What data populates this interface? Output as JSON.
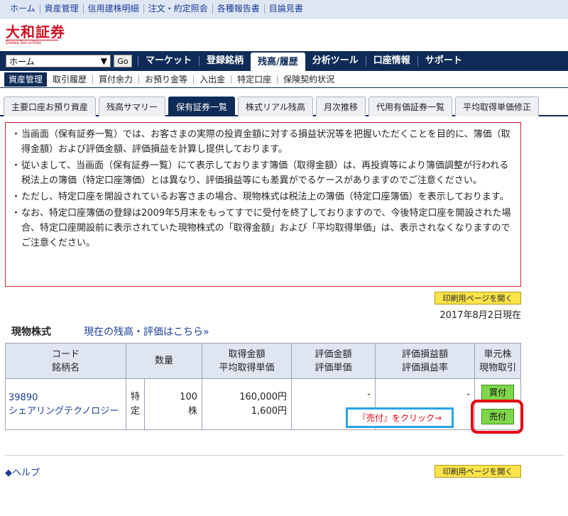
{
  "top_links": [
    "ホーム",
    "資産管理",
    "信用建株明細",
    "注文・約定照会",
    "各種報告書",
    "目論見書"
  ],
  "logo": {
    "text": "大和証券",
    "sub": "Daiwa Securities"
  },
  "navbar": {
    "search_value": "ホーム",
    "go_label": "Go",
    "items": [
      "マーケット",
      "登録銘柄",
      "残高/履歴",
      "分析ツール",
      "口座情報",
      "サポート"
    ],
    "active_index": 2
  },
  "subnav": {
    "items": [
      "資産管理",
      "取引履歴",
      "買付余力",
      "お預り金等",
      "入出金",
      "特定口座",
      "保険契約状況"
    ],
    "active_index": 0
  },
  "tabs": {
    "items": [
      "主要口座お預り資産",
      "残高サマリー",
      "保有証券一覧",
      "株式リアル残高",
      "月次推移",
      "代用有価証券一覧",
      "平均取得単価修正"
    ],
    "active_index": 2
  },
  "notice": [
    "当画面（保有証券一覧）では、お客さまの実際の投資金額に対する損益状況等を把握いただくことを目的に、簿価（取得金額）および評価金額、評価損益を計算し提供しております。",
    "従いまして、当画面（保有証券一覧）にて表示しております簿価（取得金額）は、再投資等により簿価調整が行われる税法上の簿価（特定口座簿価）とは異なり、評価損益等にも差異がでるケースがありますのでご注意ください。",
    "ただし、特定口座を開設されているお客さまの場合、現物株式は税法上の簿価（特定口座簿価）を表示しております。",
    "なお、特定口座簿価の登録は2009年5月末をもってすでに受付を終了しておりますので、今後特定口座を開設された場合、特定口座開設前に表示されていた現物株式の「取得金額」および「平均取得単価」は、表示されなくなりますのでご注意ください。"
  ],
  "print_label": "印刷用ページを開く",
  "date": "2017年8月2日現在",
  "section": {
    "title": "現物株式",
    "link": "現在の残高・評価はこちら»"
  },
  "table": {
    "headers": {
      "code": "コード",
      "name": "銘柄名",
      "qty": "数量",
      "cost": "取得金額",
      "avg": "平均取得単価",
      "value": "評価金額",
      "unit_value": "評価単価",
      "pl": "評価損益額",
      "pl_rate": "評価損益率",
      "unit_stock": "単元株",
      "spot_trade": "現物取引"
    },
    "row": {
      "code": "39890",
      "name": "シェアリングテクノロジー",
      "account_type": "特定",
      "qty": "100",
      "qty_unit": "株",
      "cost": "160,000円",
      "avg": "1,600円",
      "value": "-",
      "pl": "-",
      "buy_label": "買付",
      "sell_label": "売付"
    }
  },
  "callout": "『売付』をクリック→",
  "help": "◆ヘルプ",
  "colors": {
    "navy": "#0e2c57",
    "highlight": "#e60012",
    "callout_border": "#29a4e8",
    "trade_button": "#7ed64a",
    "print_button": "#fce44a"
  }
}
